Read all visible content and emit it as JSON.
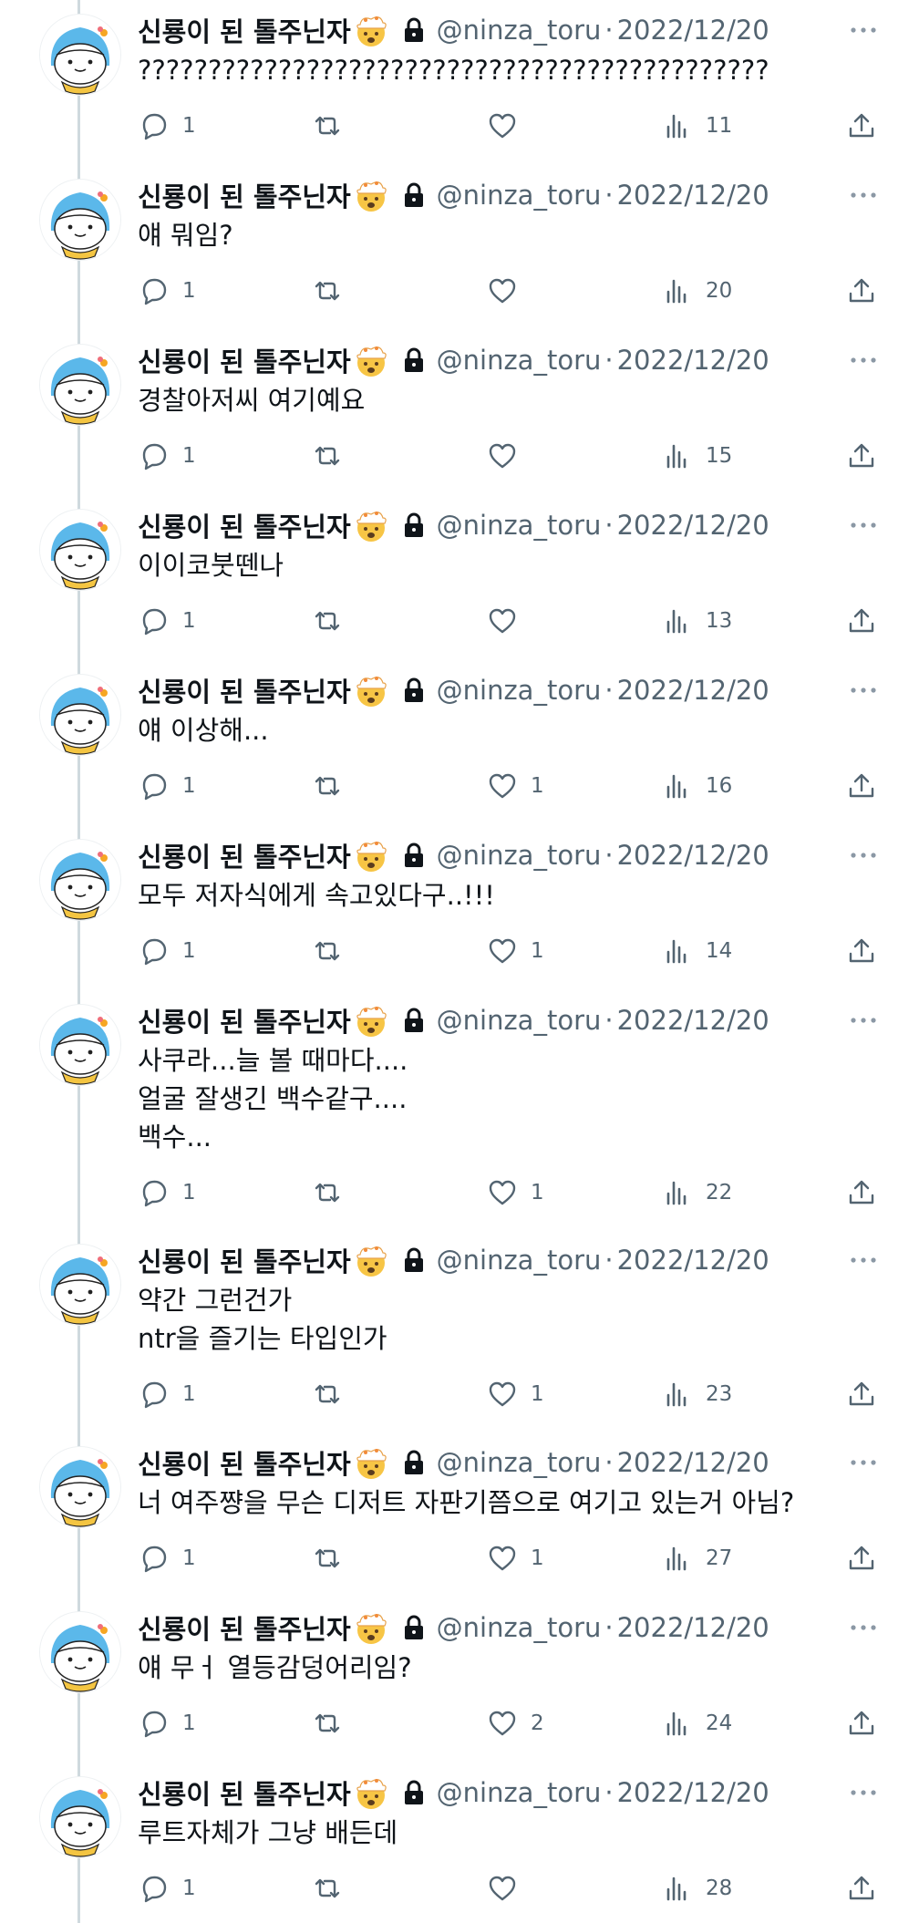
{
  "author": {
    "name": "신룡이 된 톨주닌자",
    "handle": "@ninza_toru",
    "separator": "·",
    "protected_icon": "lock-icon",
    "emoji_icon": "exploding-head-emoji"
  },
  "tweets": [
    {
      "date": "2022/12/20",
      "text": "?????????????????????????????????????????????",
      "replies": "1",
      "likes": "",
      "views": "11"
    },
    {
      "date": "2022/12/20",
      "text": "얘 뭐임?",
      "replies": "1",
      "likes": "",
      "views": "20"
    },
    {
      "date": "2022/12/20",
      "text": "경찰아저씨 여기예요",
      "replies": "1",
      "likes": "",
      "views": "15"
    },
    {
      "date": "2022/12/20",
      "text": "이이코붓뗀나",
      "replies": "1",
      "likes": "",
      "views": "13"
    },
    {
      "date": "2022/12/20",
      "text": "얘 이상해...",
      "replies": "1",
      "likes": "1",
      "views": "16"
    },
    {
      "date": "2022/12/20",
      "text": "모두 저자식에게 속고있다구..!!!",
      "replies": "1",
      "likes": "1",
      "views": "14"
    },
    {
      "date": "2022/12/20",
      "text": "사쿠라...늘 볼 때마다....\n얼굴 잘생긴 백수같구....\n백수...",
      "replies": "1",
      "likes": "1",
      "views": "22"
    },
    {
      "date": "2022/12/20",
      "text": "약간 그런건가\nntr을 즐기는 타입인가",
      "replies": "1",
      "likes": "1",
      "views": "23"
    },
    {
      "date": "2022/12/20",
      "text": "너 여주쨩을 무슨 디저트 자판기쯤으로 여기고 있는거 아님?",
      "replies": "1",
      "likes": "1",
      "views": "27"
    },
    {
      "date": "2022/12/20",
      "text": "얘 무ㅓ 열등감덩어리임?",
      "replies": "1",
      "likes": "2",
      "views": "24"
    },
    {
      "date": "2022/12/20",
      "text": "루트자체가 그냥 배든데",
      "replies": "1",
      "likes": "",
      "views": "28"
    }
  ]
}
